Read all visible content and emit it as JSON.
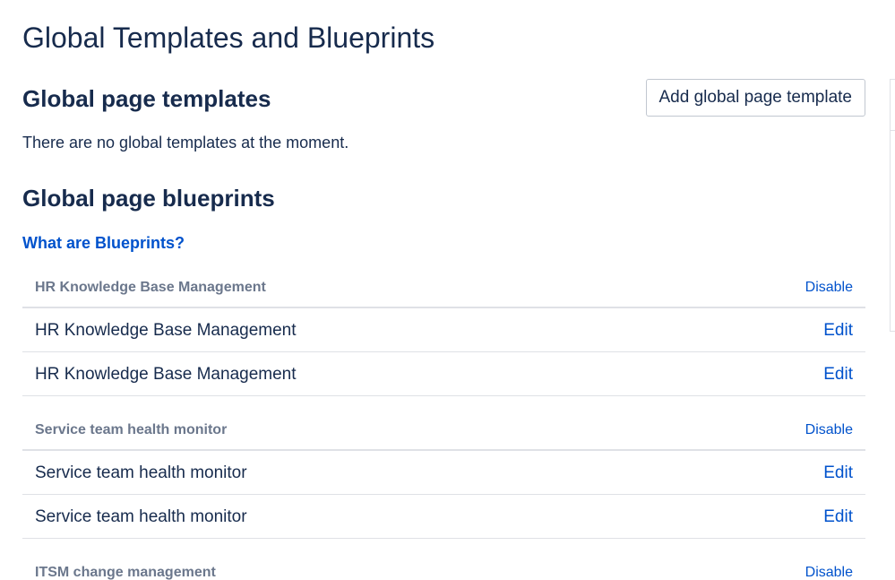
{
  "page": {
    "title": "Global Templates and Blueprints"
  },
  "templates": {
    "heading": "Global page templates",
    "add_button_label": "Add global page template",
    "empty_message": "There are no global templates at the moment."
  },
  "blueprints": {
    "heading": "Global page blueprints",
    "help_link": "What are Blueprints?",
    "groups": [
      {
        "name": "HR Knowledge Base Management",
        "action": "Disable",
        "items": [
          {
            "name": "HR Knowledge Base Management",
            "action": "Edit"
          },
          {
            "name": "HR Knowledge Base Management",
            "action": "Edit"
          }
        ]
      },
      {
        "name": "Service team health monitor",
        "action": "Disable",
        "items": [
          {
            "name": "Service team health monitor",
            "action": "Edit"
          },
          {
            "name": "Service team health monitor",
            "action": "Edit"
          }
        ]
      },
      {
        "name": "ITSM change management",
        "action": "Disable",
        "items": []
      }
    ]
  },
  "colors": {
    "text": "#172b4d",
    "muted": "#6b778c",
    "link": "#0052cc",
    "border": "#dfe1e6"
  }
}
